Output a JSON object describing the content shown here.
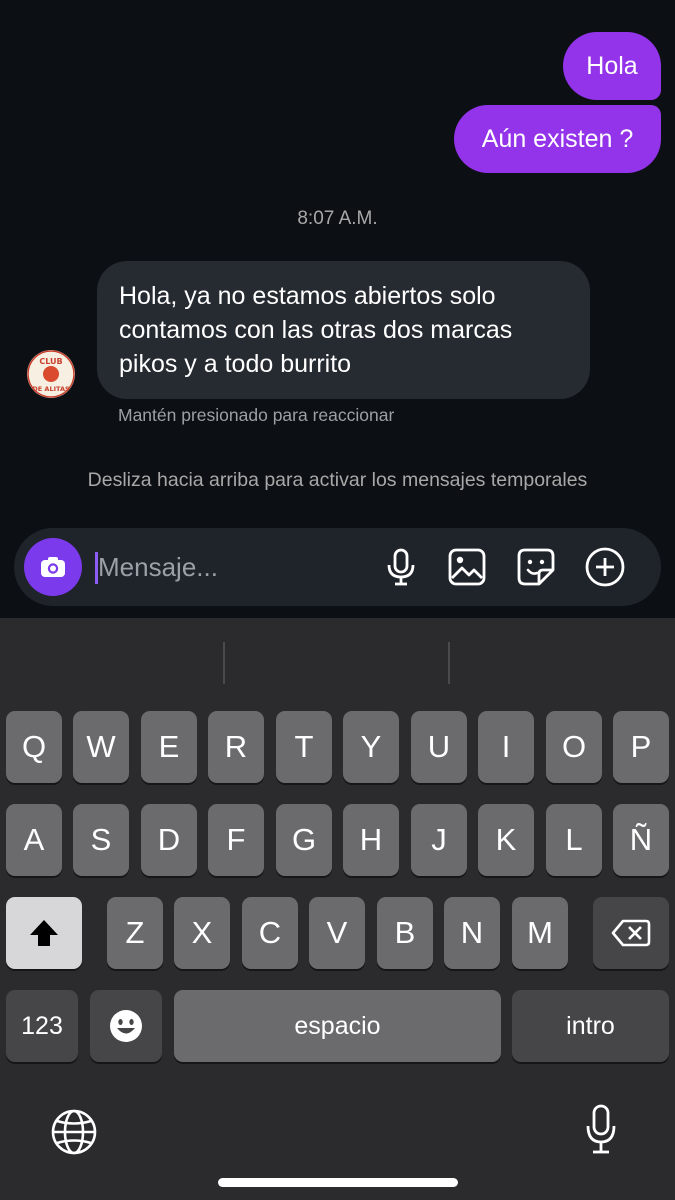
{
  "conversation": {
    "outgoing": [
      {
        "text": "Hola"
      },
      {
        "text": "Aún existen ?"
      }
    ],
    "timestamp": "8:07 A.M.",
    "incoming": {
      "lines": [
        "Hola, ya no estamos abiertos solo",
        "contamos con las otras dos marcas",
        "pikos y a todo burrito"
      ],
      "hint": "Mantén presionado para reaccionar"
    },
    "avatar": {
      "line1": "CLUB",
      "line2": "DE ALITAS"
    },
    "ephemeral_notice": "Desliza hacia arriba para activar los mensajes temporales"
  },
  "composer": {
    "placeholder": "Mensaje...",
    "icons": [
      "camera-icon",
      "microphone-icon",
      "gallery-icon",
      "sticker-icon",
      "add-icon"
    ]
  },
  "keyboard": {
    "row1": [
      "Q",
      "W",
      "E",
      "R",
      "T",
      "Y",
      "U",
      "I",
      "O",
      "P"
    ],
    "row2": [
      "A",
      "S",
      "D",
      "F",
      "G",
      "H",
      "J",
      "K",
      "L",
      "Ñ"
    ],
    "row3": [
      "Z",
      "X",
      "C",
      "V",
      "B",
      "N",
      "M"
    ],
    "numbers_label": "123",
    "space_label": "espacio",
    "return_label": "intro",
    "icons": [
      "shift-icon",
      "backspace-icon",
      "emoji-icon",
      "globe-icon",
      "dictation-icon"
    ]
  },
  "colors": {
    "background": "#0c1014",
    "outgoing_bubble": "#9333ea",
    "incoming_bubble": "#262a31",
    "camera_button": "#7c3aed",
    "key": "#6b6b6e"
  }
}
